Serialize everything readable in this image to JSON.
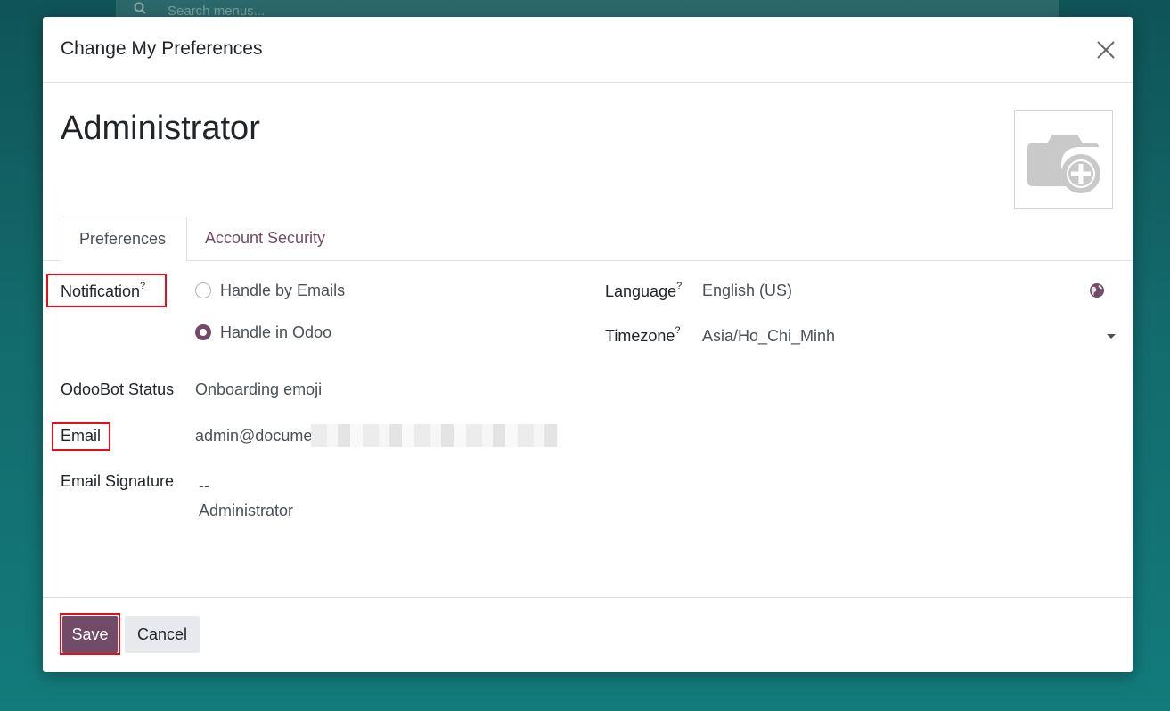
{
  "background": {
    "search_placeholder": "Search menus..."
  },
  "dialog": {
    "title": "Change My Preferences",
    "record_name": "Administrator"
  },
  "tabs": [
    {
      "label": "Preferences",
      "active": true
    },
    {
      "label": "Account Security",
      "active": false
    }
  ],
  "fields": {
    "notification": {
      "label": "Notification",
      "help": "?",
      "options": [
        {
          "label": "Handle by Emails",
          "selected": false
        },
        {
          "label": "Handle in Odoo",
          "selected": true
        }
      ]
    },
    "odoobot_status": {
      "label": "OdooBot Status",
      "value": "Onboarding emoji"
    },
    "email": {
      "label": "Email",
      "value": "admin@docume"
    },
    "email_signature": {
      "label": "Email Signature",
      "line1": "--",
      "line2": "Administrator"
    },
    "language": {
      "label": "Language",
      "help": "?",
      "value": "English (US)"
    },
    "timezone": {
      "label": "Timezone",
      "help": "?",
      "value": "Asia/Ho_Chi_Minh"
    }
  },
  "footer": {
    "save_label": "Save",
    "cancel_label": "Cancel"
  },
  "colors": {
    "primary": "#714b67",
    "highlight": "#e0101c",
    "background": "#136a6c"
  },
  "icons": [
    "search-icon",
    "close-icon",
    "camera-plus-icon",
    "globe-icon",
    "caret-down-icon"
  ]
}
